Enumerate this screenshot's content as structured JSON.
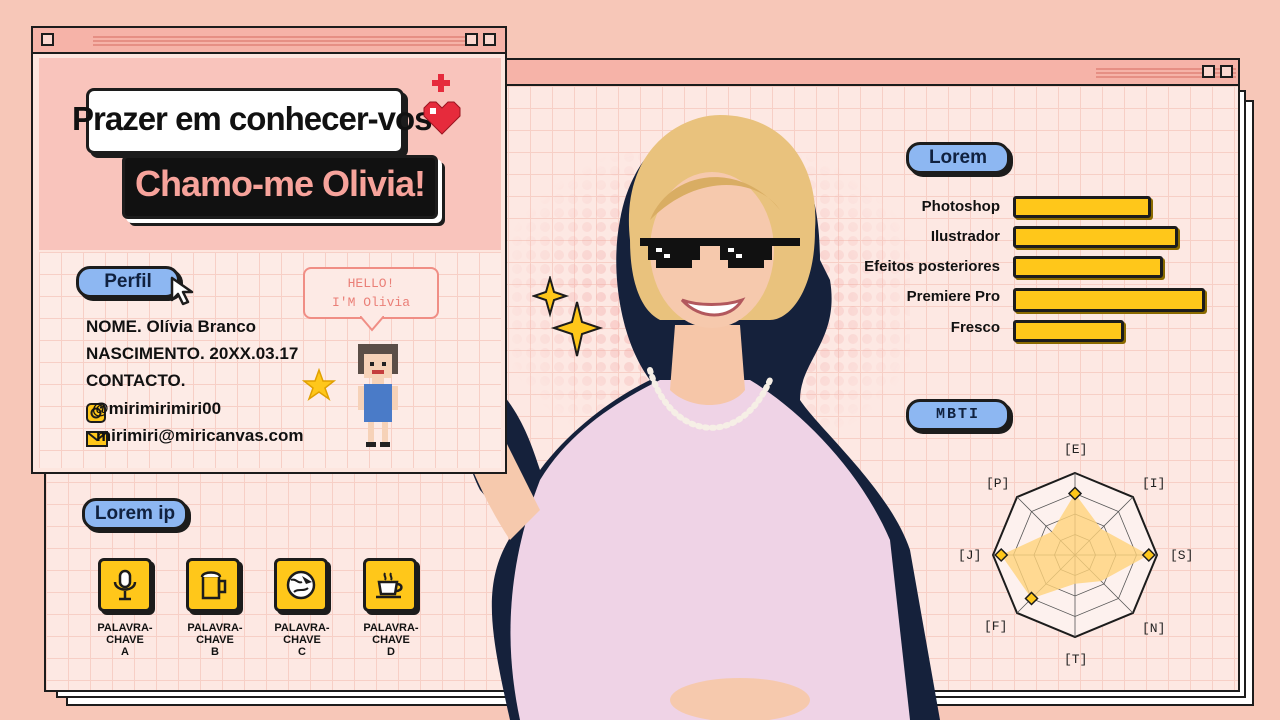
{
  "intro": {
    "greeting": "Prazer em conhecer-vos",
    "name_banner": "Chamo-me Olivia!"
  },
  "profile": {
    "title": "Perfil",
    "bubble_line1": "HELLO!",
    "bubble_line2": "I'M Olivia",
    "name": "NOME. Olívia Branco",
    "birth": "NASCIMENTO. 20XX.03.17",
    "contact": "CONTACTO.",
    "instagram": "@mirimirimiri00",
    "email": "mirimiri@miricanvas.com"
  },
  "skills": {
    "title": "Lorem",
    "items": [
      {
        "label": "Photoshop",
        "level": 0.72
      },
      {
        "label": "Ilustrador",
        "level": 0.86
      },
      {
        "label": "Efeitos posteriores",
        "level": 0.78
      },
      {
        "label": "Premiere Pro",
        "level": 1.0
      },
      {
        "label": "Fresco",
        "level": 0.58
      }
    ],
    "bar_color": "#ffc71a"
  },
  "mbti": {
    "title": "MBTI",
    "axes": [
      "[E]",
      "[I]",
      "[S]",
      "[N]",
      "[T]",
      "[F]",
      "[J]",
      "[P]"
    ],
    "values": [
      0.75,
      0.45,
      0.9,
      0.45,
      0.35,
      0.75,
      0.9,
      0.4
    ],
    "fill_color": "#ffd37a"
  },
  "keywords": {
    "title": "Lorem ip",
    "items": [
      {
        "label": "PALAVRA-CHAVE",
        "sub": "A",
        "icon": "microphone-icon"
      },
      {
        "label": "PALAVRA-CHAVE",
        "sub": "B",
        "icon": "beer-mug-icon"
      },
      {
        "label": "PALAVRA-CHAVE",
        "sub": "C",
        "icon": "globe-plane-icon"
      },
      {
        "label": "PALAVRA-CHAVE",
        "sub": "D",
        "icon": "coffee-cup-icon"
      }
    ]
  },
  "colors": {
    "background": "#f7c7b8",
    "accent_pink": "#f6a197",
    "pill_blue": "#8db7f2",
    "yellow": "#ffc71a"
  }
}
